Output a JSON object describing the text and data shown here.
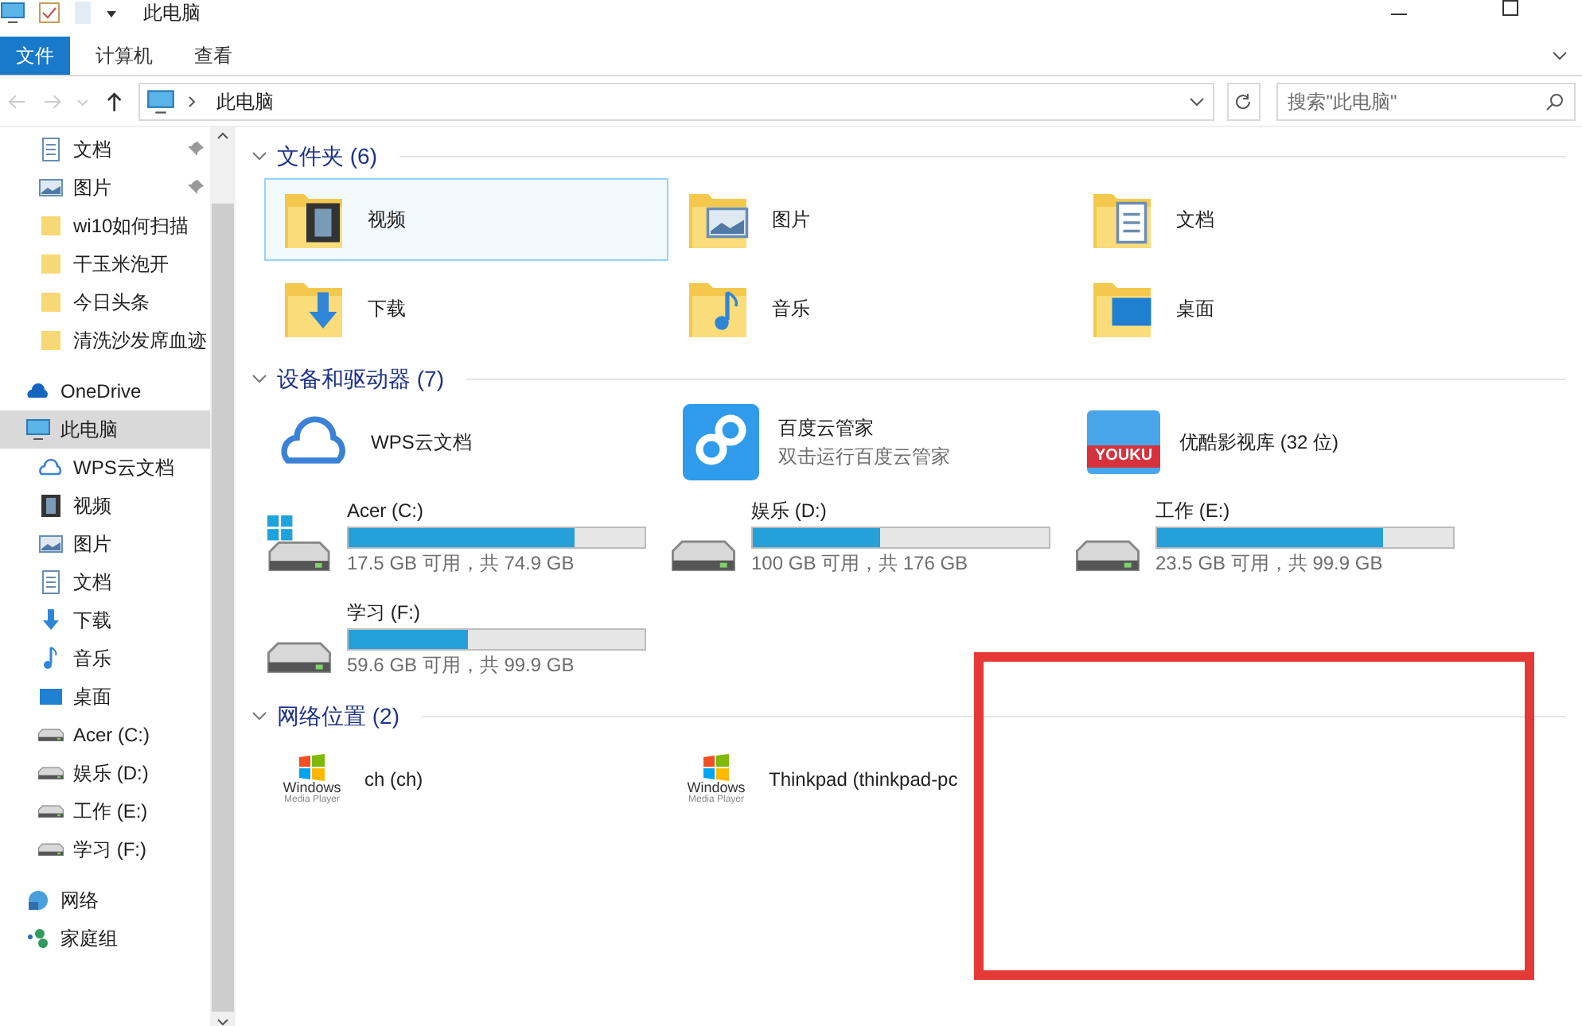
{
  "window": {
    "title": "此电脑"
  },
  "ribbon_tabs": [
    {
      "label": "文件",
      "selected": true
    },
    {
      "label": "计算机",
      "selected": false
    },
    {
      "label": "查看",
      "selected": false
    }
  ],
  "address": {
    "path": "此电脑"
  },
  "search": {
    "placeholder": "搜索\"此电脑\""
  },
  "sidebar": {
    "items": [
      {
        "label": "文档",
        "kind": "document",
        "pinned": true,
        "selected": false
      },
      {
        "label": "图片",
        "kind": "picture",
        "pinned": true,
        "selected": false
      },
      {
        "label": "wi10如何扫描",
        "kind": "folder",
        "pinned": false,
        "selected": false
      },
      {
        "label": "干玉米泡开",
        "kind": "folder",
        "pinned": false,
        "selected": false
      },
      {
        "label": "今日头条",
        "kind": "folder",
        "pinned": false,
        "selected": false
      },
      {
        "label": "清洗沙发席血迹",
        "kind": "folder",
        "pinned": false,
        "selected": false
      },
      {
        "label": "OneDrive",
        "kind": "cloud",
        "pinned": false,
        "selected": false,
        "top": true
      },
      {
        "label": "此电脑",
        "kind": "pc",
        "pinned": false,
        "selected": true,
        "top": true
      },
      {
        "label": "WPS云文档",
        "kind": "wps",
        "pinned": false,
        "selected": false
      },
      {
        "label": "视频",
        "kind": "video",
        "pinned": false,
        "selected": false
      },
      {
        "label": "图片",
        "kind": "picture",
        "pinned": false,
        "selected": false
      },
      {
        "label": "文档",
        "kind": "document",
        "pinned": false,
        "selected": false
      },
      {
        "label": "下载",
        "kind": "download",
        "pinned": false,
        "selected": false
      },
      {
        "label": "音乐",
        "kind": "music",
        "pinned": false,
        "selected": false
      },
      {
        "label": "桌面",
        "kind": "desktop",
        "pinned": false,
        "selected": false
      },
      {
        "label": "Acer (C:)",
        "kind": "drive",
        "pinned": false,
        "selected": false
      },
      {
        "label": "娱乐 (D:)",
        "kind": "drive",
        "pinned": false,
        "selected": false
      },
      {
        "label": "工作 (E:)",
        "kind": "drive",
        "pinned": false,
        "selected": false
      },
      {
        "label": "学习 (F:)",
        "kind": "drive",
        "pinned": false,
        "selected": false
      },
      {
        "label": "网络",
        "kind": "network",
        "pinned": false,
        "selected": false,
        "top": true
      },
      {
        "label": "家庭组",
        "kind": "homegroup",
        "pinned": false,
        "selected": false,
        "top": true
      }
    ]
  },
  "sections": [
    {
      "title": "文件夹 (6)",
      "items": [
        {
          "kind": "video",
          "name": "视频",
          "selected": true
        },
        {
          "kind": "picture",
          "name": "图片",
          "selected": false
        },
        {
          "kind": "document",
          "name": "文档",
          "selected": false
        },
        {
          "kind": "download",
          "name": "下载",
          "selected": false
        },
        {
          "kind": "music",
          "name": "音乐",
          "selected": false
        },
        {
          "kind": "desktop",
          "name": "桌面",
          "selected": false
        }
      ]
    },
    {
      "title": "设备和驱动器 (7)",
      "items": [
        {
          "kind": "wps",
          "name": "WPS云文档"
        },
        {
          "kind": "baidu",
          "name": "百度云管家",
          "subtitle": "双击运行百度云管家"
        },
        {
          "kind": "youku",
          "name": "优酷影视库 (32 位)",
          "logo_text": "YOUKU"
        },
        {
          "kind": "drive",
          "name": "Acer (C:)",
          "system": true,
          "level": 0.766,
          "space": "17.5 GB 可用，共 74.9 GB"
        },
        {
          "kind": "drive",
          "name": "娱乐 (D:)",
          "system": false,
          "level": 0.432,
          "space": "100 GB 可用，共 176 GB"
        },
        {
          "kind": "drive",
          "name": "工作 (E:)",
          "system": false,
          "level": 0.765,
          "space": "23.5 GB 可用，共 99.9 GB"
        },
        {
          "kind": "drive",
          "name": "学习 (F:)",
          "system": false,
          "level": 0.403,
          "space": "59.6 GB 可用，共 99.9 GB"
        }
      ]
    },
    {
      "title": "网络位置 (2)",
      "items": [
        {
          "kind": "media",
          "name": "ch (ch)",
          "logo_text": "Windows",
          "logo_subtext": "Media Player"
        },
        {
          "kind": "media",
          "name": "Thinkpad (thinkpad-pc",
          "logo_text": "Windows",
          "logo_subtext": "Media Player"
        }
      ]
    }
  ]
}
